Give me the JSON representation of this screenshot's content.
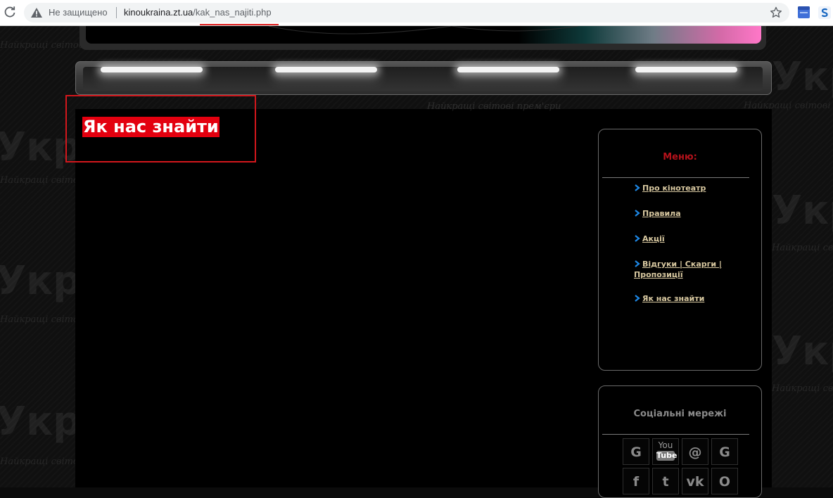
{
  "browser": {
    "security_label": "Не защищено",
    "url_host": "kinoukraina.zt.ua",
    "url_path": "/kak_nas_najiti.php"
  },
  "page": {
    "title": "Як нас знайти"
  },
  "sidebar": {
    "menu": {
      "title": "Меню:",
      "items": [
        {
          "label": "Про кінотеатр"
        },
        {
          "label": "Правила"
        },
        {
          "label": "Акції"
        },
        {
          "label": "Відгуки | Скарги | Пропозиції"
        },
        {
          "label": "Як нас знайти"
        }
      ]
    },
    "social": {
      "title": "Соціальні мережі",
      "icons": [
        {
          "name": "google-icon",
          "glyph": "G"
        },
        {
          "name": "youtube-icon",
          "top": "You",
          "bottom": "Tube"
        },
        {
          "name": "mail-icon",
          "glyph": "@"
        },
        {
          "name": "google-plus-icon",
          "glyph": "G"
        },
        {
          "name": "facebook-icon",
          "glyph": "f"
        },
        {
          "name": "twitter-icon",
          "glyph": "t"
        },
        {
          "name": "vk-icon",
          "glyph": "vk"
        },
        {
          "name": "odnoklassniki-icon",
          "glyph": "O"
        }
      ]
    }
  },
  "colors": {
    "heading_bg": "#e3000f",
    "heading_outline": "#d3171c",
    "menu_title": "#b5121b",
    "social_title": "#8a8a8a",
    "link": "#d9c9a1",
    "chevron": "#1e88e5"
  }
}
